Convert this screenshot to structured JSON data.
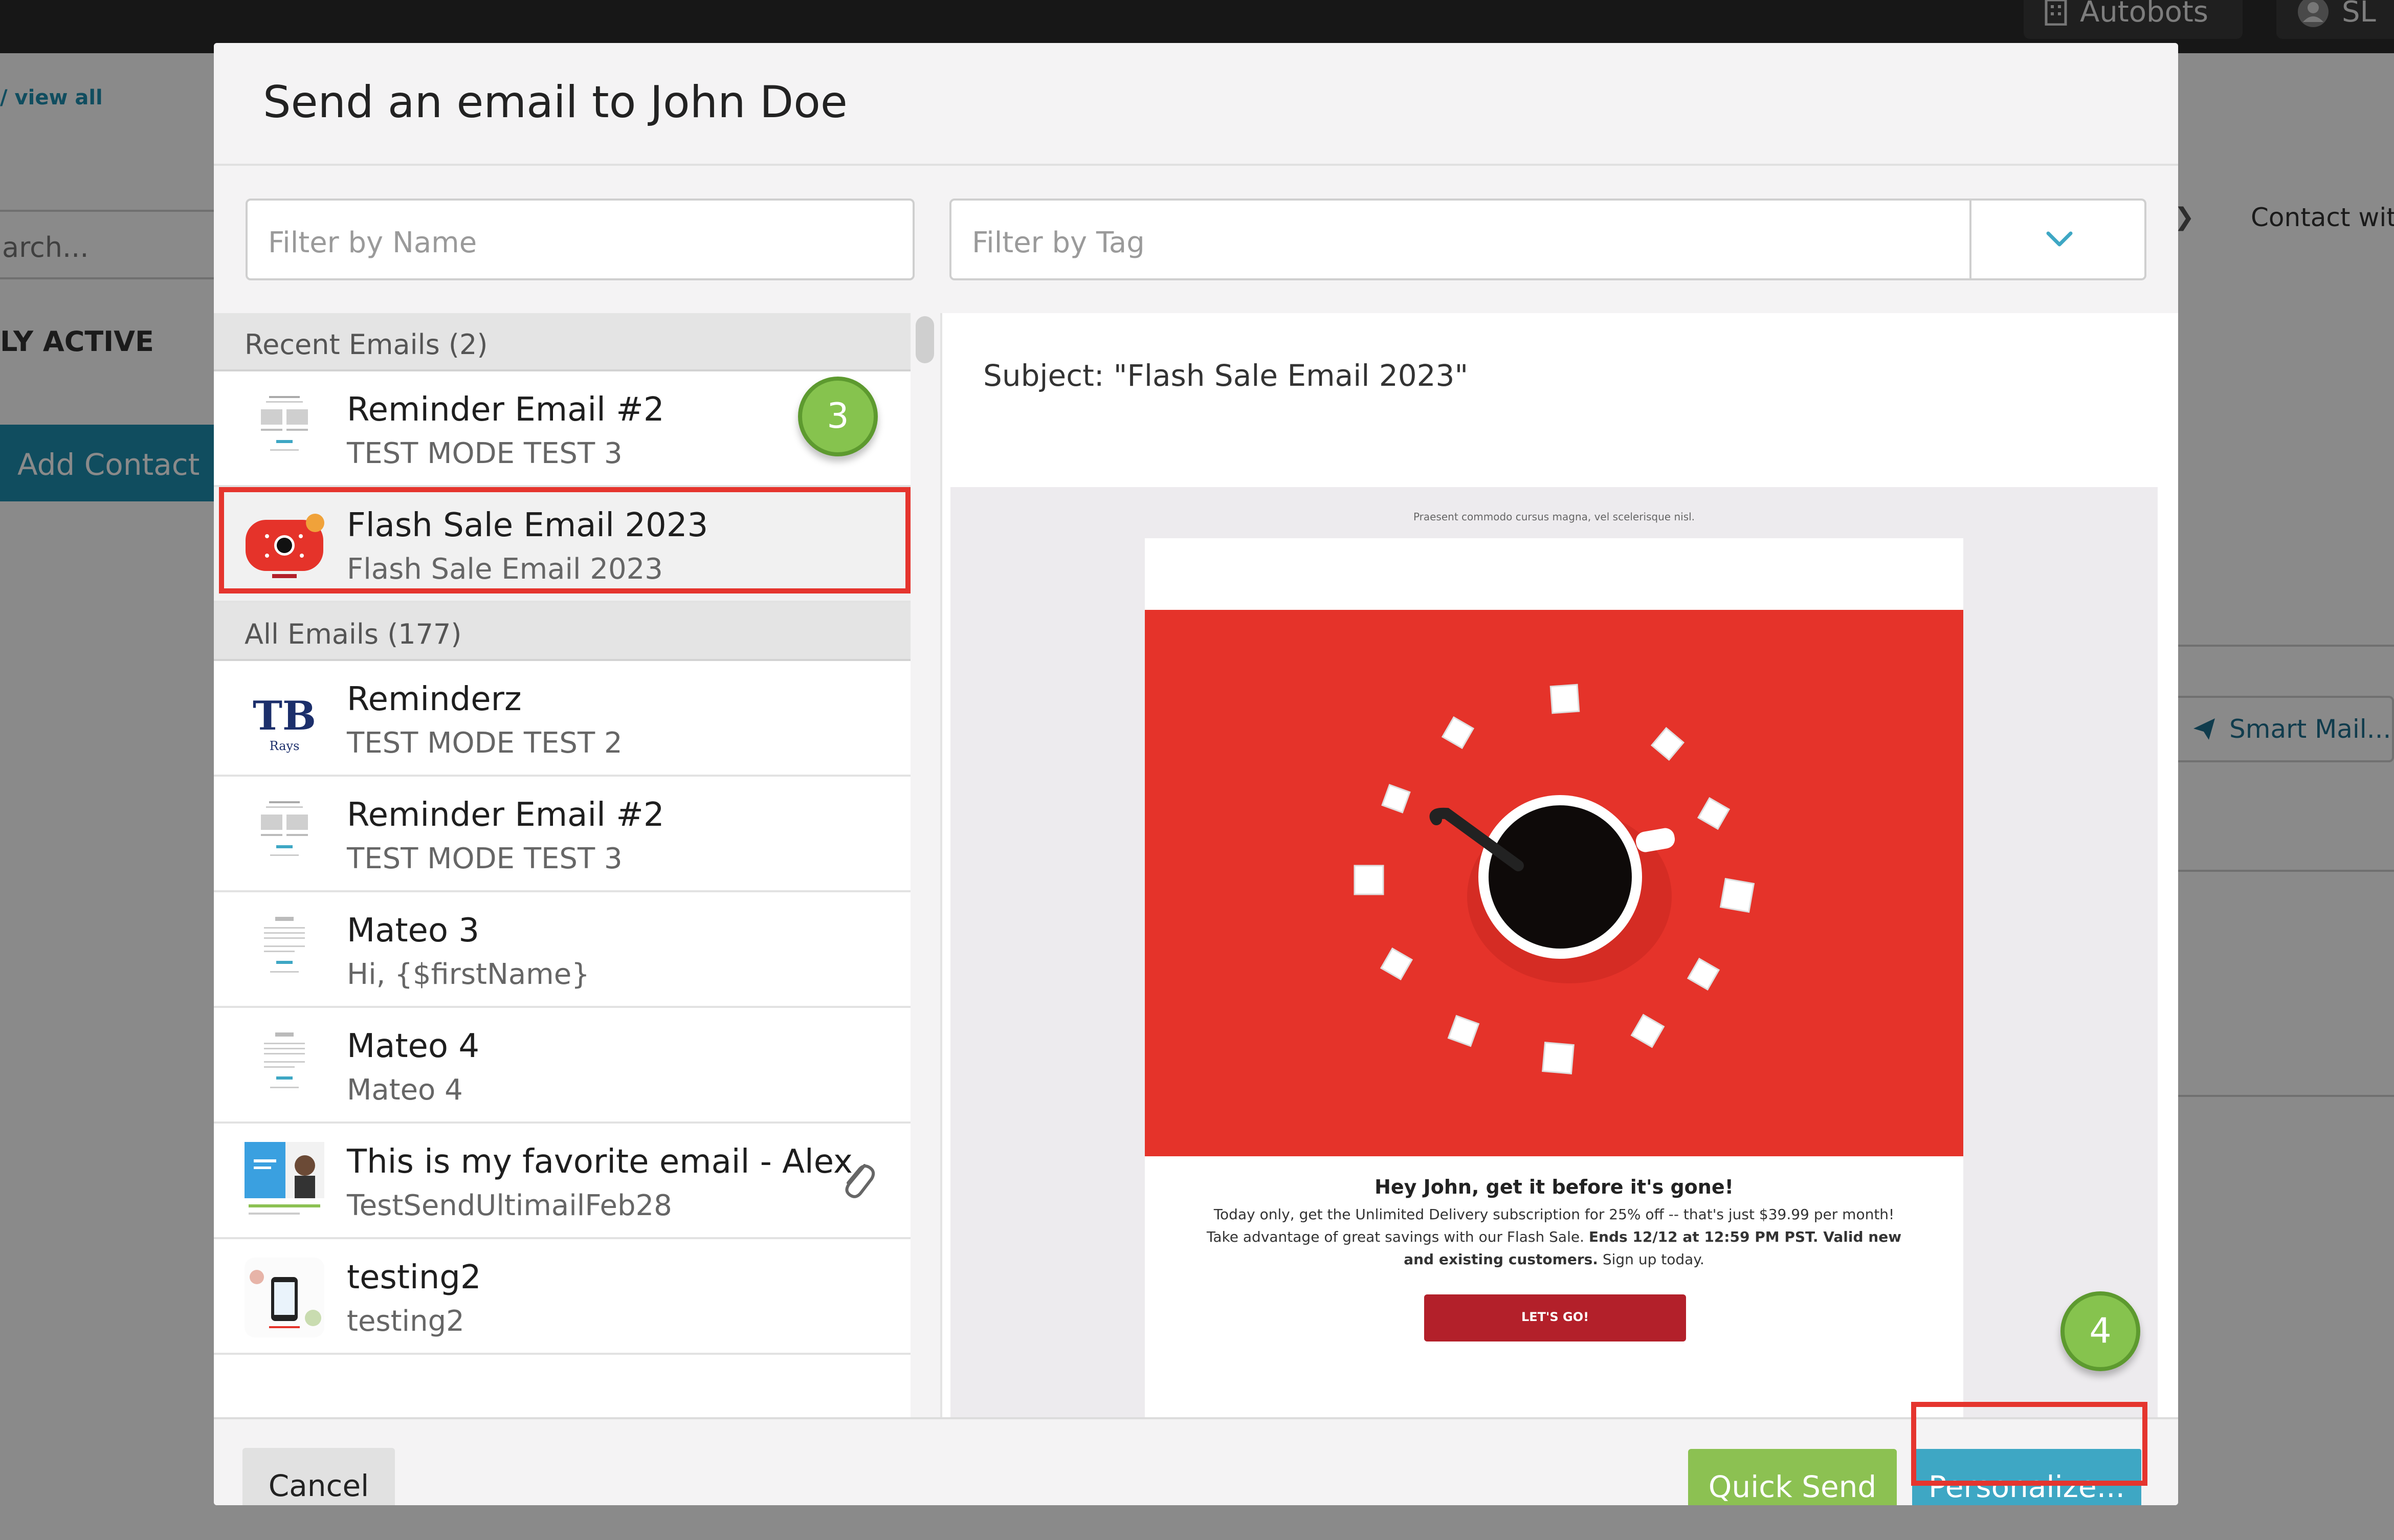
{
  "background": {
    "top_right": {
      "org_label": "Autobots",
      "user_initials": "SL"
    },
    "breadcrumb": "/ view all",
    "search_placeholder": "arch...",
    "status_label": "LY ACTIVE",
    "add_contact_label": "Add Contact",
    "contact_with_label": "Contact with",
    "smart_mail_label": "Smart Mail..."
  },
  "modal": {
    "title": "Send an email to John Doe",
    "filter_name_placeholder": "Filter by Name",
    "filter_tag_placeholder": "Filter by Tag",
    "recent_header": "Recent Emails (2)",
    "recent_emails": [
      {
        "name": "Reminder Email #2",
        "subject": "TEST MODE TEST 3"
      },
      {
        "name": "Flash Sale Email 2023",
        "subject": "Flash Sale Email 2023"
      }
    ],
    "all_header": "All Emails (177)",
    "all_emails": [
      {
        "name": "Reminderz",
        "subject": "TEST MODE TEST 2"
      },
      {
        "name": "Reminder Email #2",
        "subject": "TEST MODE TEST 3"
      },
      {
        "name": "Mateo 3",
        "subject": "Hi, {$firstName}"
      },
      {
        "name": "Mateo 4",
        "subject": "Mateo 4"
      },
      {
        "name": "This is my favorite email - Alex",
        "subject": "TestSendUltimailFeb28",
        "has_attachment": true
      },
      {
        "name": "testing2",
        "subject": "testing2"
      }
    ],
    "preview": {
      "subject": "Subject: \"Flash Sale Email 2023\"",
      "preheader": "Praesent commodo cursus magna, vel scelerisque nisl.",
      "headline": "Hey John, get it before it's gone!",
      "body_1": "Today only, get the Unlimited Delivery subscription for 25% off -- that's just $39.99 per month! Take advantage of great savings with our Flash Sale.",
      "body_bold": "Ends 12/12 at 12:59 PM PST. Valid new and existing customers.",
      "body_2": "Sign up today.",
      "cta": "LET'S GO!"
    },
    "buttons": {
      "cancel": "Cancel",
      "quick_send": "Quick Send",
      "personalize": "Personalize..."
    },
    "selected_index": 1
  },
  "annotations": {
    "step_3": "3",
    "step_4": "4"
  },
  "colors": {
    "accent_blue": "#3ea7c4",
    "quick_send_green": "#8cc152",
    "highlight_red": "#e5352e",
    "hero_red": "#e5332a",
    "cta_red": "#b3202a"
  }
}
